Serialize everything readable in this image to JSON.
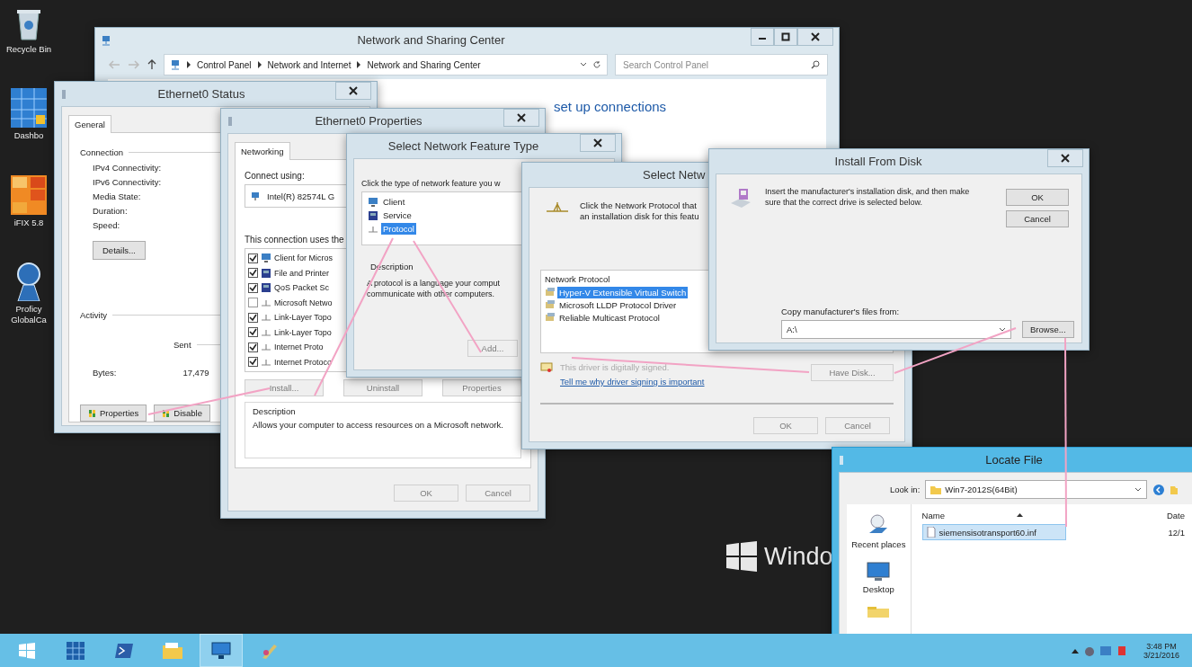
{
  "desktop": {
    "icons": [
      {
        "label": "Recycle Bin",
        "kind": "bin"
      },
      {
        "label": "Dashbo",
        "kind": "dashboard"
      },
      {
        "label": "iFIX 5.8",
        "kind": "ifix"
      },
      {
        "label": "Proficy GlobalCa",
        "kind": "proficy"
      }
    ],
    "brand": "Windo"
  },
  "network_center": {
    "title": "Network and Sharing Center",
    "breadcrumb": [
      "Control Panel",
      "Network and Internet",
      "Network and Sharing Center"
    ],
    "search": {
      "placeholder": "Search Control Panel"
    },
    "heading": "set up connections"
  },
  "status": {
    "title": "Ethernet0 Status",
    "tabs": [
      {
        "label": "General",
        "selected": true
      }
    ],
    "connection_heading": "Connection",
    "fields": [
      "IPv4 Connectivity:",
      "IPv6 Connectivity:",
      "Media State:",
      "Duration:",
      "Speed:"
    ],
    "details_button": "Details...",
    "activity_heading": "Activity",
    "sent_label": "Sent",
    "bytes_label": "Bytes:",
    "bytes_sent": "17,479",
    "buttons": [
      {
        "label": "Properties",
        "disabled": false
      },
      {
        "label": "Disable",
        "disabled": false
      }
    ]
  },
  "properties": {
    "title": "Ethernet0 Properties",
    "tabs": [
      {
        "label": "Networking",
        "selected": true
      }
    ],
    "connect_using_label": "Connect using:",
    "adapter": "Intel(R) 82574L G",
    "items_label": "This connection uses the",
    "items": [
      {
        "label": "Client for Micros",
        "kind": "client",
        "checked": true
      },
      {
        "label": "File and Printer",
        "kind": "service",
        "checked": true
      },
      {
        "label": "QoS Packet Sc",
        "kind": "service",
        "checked": true
      },
      {
        "label": "Microsoft Netwo",
        "kind": "protocol",
        "checked": false
      },
      {
        "label": "Link-Layer Topo",
        "kind": "protocol",
        "checked": true
      },
      {
        "label": "Link-Layer Topo",
        "kind": "protocol",
        "checked": true
      },
      {
        "label": "Internet Proto",
        "kind": "protocol",
        "checked": true
      },
      {
        "label": "Internet Protoco",
        "kind": "protocol",
        "checked": true
      }
    ],
    "buttons": [
      {
        "label": "Install...",
        "disabled": true
      },
      {
        "label": "Uninstall",
        "disabled": true
      },
      {
        "label": "Properties",
        "disabled": true
      }
    ],
    "description_heading": "Description",
    "description": "Allows your computer to access resources on a Microsoft network.",
    "footer_buttons": [
      {
        "label": "OK",
        "disabled": true
      },
      {
        "label": "Cancel",
        "disabled": true
      }
    ]
  },
  "feature_type": {
    "title": "Select Network Feature Type",
    "prompt": "Click the type of network feature you w",
    "items": [
      {
        "label": "Client",
        "kind": "client",
        "selected": false
      },
      {
        "label": "Service",
        "kind": "service",
        "selected": false
      },
      {
        "label": "Protocol",
        "kind": "protocol",
        "selected": true
      }
    ],
    "description_heading": "Description",
    "description_lines": [
      "A protocol is a language your comput",
      "communicate with other computers."
    ],
    "add_button": {
      "label": "Add...",
      "disabled": true
    }
  },
  "protocol": {
    "title": "Select Netw",
    "prompt_lines": [
      "Click the Network Protocol that",
      "an installation disk for this featu"
    ],
    "list_header": "Network Protocol",
    "items": [
      {
        "label": "Hyper-V Extensible Virtual Switch",
        "selected": true
      },
      {
        "label": "Microsoft LLDP Protocol Driver",
        "selected": false
      },
      {
        "label": "Reliable Multicast Protocol",
        "selected": false
      }
    ],
    "signed_note": "This driver is digitally signed.",
    "link": "Tell me why driver signing is important",
    "have_disk": {
      "label": "Have Disk...",
      "disabled": true
    },
    "footer_buttons": [
      {
        "label": "OK",
        "disabled": true
      },
      {
        "label": "Cancel",
        "disabled": true
      }
    ]
  },
  "install": {
    "title": "Install From Disk",
    "message": "Insert the manufacturer's installation disk, and then make sure that the correct drive is selected below.",
    "buttons": [
      {
        "label": "OK",
        "disabled": false
      },
      {
        "label": "Cancel",
        "disabled": false
      }
    ],
    "copy_label": "Copy manufacturer's files from:",
    "path": "A:\\",
    "browse": {
      "label": "Browse...",
      "disabled": false
    }
  },
  "locate": {
    "title": "Locate File",
    "look_in_label": "Look in:",
    "folder": "Win7-2012S(64Bit)",
    "places": [
      {
        "label": "Recent places",
        "kind": "recent"
      },
      {
        "label": "Desktop",
        "kind": "desktop"
      }
    ],
    "columns": [
      "Name",
      "Date"
    ],
    "rows": [
      {
        "name": "siemensisotransport60.inf",
        "date": "12/1",
        "selected": true
      }
    ]
  },
  "taskbar": {
    "apps": [
      {
        "kind": "server_manager",
        "selected": false
      },
      {
        "kind": "powershell",
        "selected": false
      },
      {
        "kind": "explorer",
        "selected": false
      },
      {
        "kind": "network",
        "selected": true
      },
      {
        "kind": "paint",
        "selected": false
      }
    ],
    "time": "3:48 PM",
    "date": "3/21/2016"
  }
}
